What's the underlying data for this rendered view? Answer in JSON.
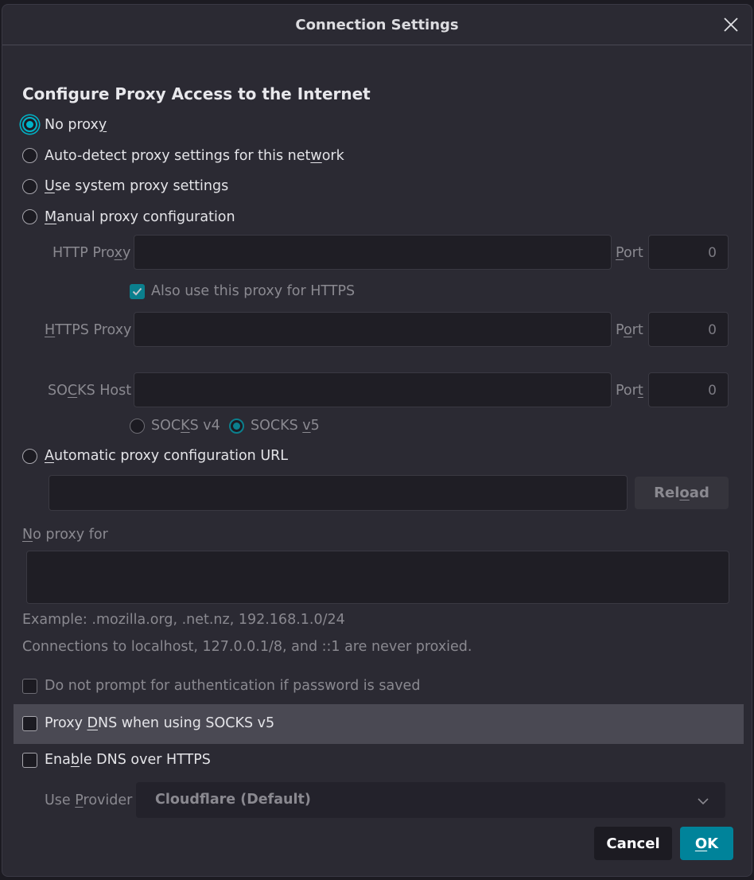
{
  "dialog": {
    "title": "Connection Settings",
    "close_icon": "close-icon"
  },
  "section_heading": "Configure Proxy Access to the Internet",
  "proxy_options": {
    "no_proxy": {
      "pre": "No prox",
      "key": "y",
      "post": "",
      "checked": true
    },
    "auto_detect": {
      "pre": "Auto-detect proxy settings for this net",
      "key": "w",
      "post": "ork",
      "checked": false
    },
    "system": {
      "pre": "",
      "key": "U",
      "post": "se system proxy settings",
      "checked": false
    },
    "manual": {
      "pre": "",
      "key": "M",
      "post": "anual proxy configuration",
      "checked": false
    },
    "auto_url": {
      "pre": "",
      "key": "A",
      "post": "utomatic proxy configuration URL",
      "checked": false
    }
  },
  "manual": {
    "http_label": {
      "pre": "HTTP Pro",
      "key": "x",
      "post": "y"
    },
    "http_value": "",
    "port_label": {
      "pre": "",
      "key": "P",
      "post": "ort"
    },
    "port_label_alt": {
      "pre": "P",
      "key": "o",
      "post": "rt"
    },
    "port_label_socks": {
      "pre": "Por",
      "key": "t",
      "post": ""
    },
    "http_port": "0",
    "also_https": {
      "pre": "Also use this proxy for HTTPS",
      "checked": true
    },
    "https_label": {
      "pre": "",
      "key": "H",
      "post": "TTPS Proxy"
    },
    "https_value": "",
    "https_port": "0",
    "socks_label": {
      "pre": "SO",
      "key": "C",
      "post": "KS Host"
    },
    "socks_value": "",
    "socks_port": "0",
    "socks_v4": {
      "pre": "SOC",
      "key": "K",
      "post": "S v4",
      "checked": false
    },
    "socks_v5": {
      "pre": "SOCKS ",
      "key": "v",
      "post": "5",
      "checked": true
    }
  },
  "auto_url_value": "",
  "reload_button": {
    "pre": "Rel",
    "key": "o",
    "post": "ad"
  },
  "no_proxy_for": {
    "label": {
      "pre": "",
      "key": "N",
      "post": "o proxy for"
    },
    "value": "",
    "example": "Example: .mozilla.org, .net.nz, 192.168.1.0/24",
    "note": "Connections to localhost, 127.0.0.1/8, and ::1 are never proxied."
  },
  "checkboxes": {
    "no_prompt": {
      "label": "Do not prompt for authentication if password is saved",
      "checked": false
    },
    "proxy_dns": {
      "pre": "Proxy ",
      "key": "D",
      "post": "NS when using SOCKS v5",
      "checked": false
    },
    "dns_https": {
      "pre": "Ena",
      "key": "b",
      "post": "le DNS over HTTPS",
      "checked": false
    }
  },
  "provider": {
    "label": {
      "pre": "Use ",
      "key": "P",
      "post": "rovider"
    },
    "selected": "Cloudflare (Default)"
  },
  "buttons": {
    "cancel": "Cancel",
    "ok": {
      "pre": "",
      "key": "O",
      "post": "K"
    }
  },
  "colors": {
    "accent": "#00b3c7",
    "ok_button": "#00839a",
    "background": "#2b2a33"
  }
}
